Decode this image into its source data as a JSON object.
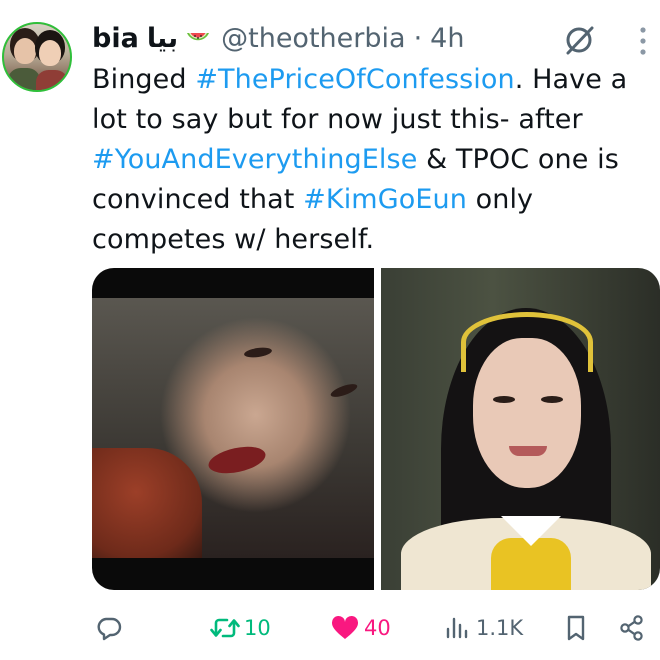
{
  "author": {
    "name": "bia",
    "name_arabic": "بيا",
    "emoji_icon": "watermelon-icon",
    "handle": "@theotherbia",
    "separator": "·",
    "time": "4h"
  },
  "tweet": {
    "lines": [
      [
        {
          "t": "Binged ",
          "tag": false
        },
        {
          "t": "#ThePriceOfConfession",
          "tag": true
        },
        {
          "t": ". Have a",
          "tag": false
        }
      ],
      [
        {
          "t": "lot to say but for now just this- after",
          "tag": false
        }
      ],
      [
        {
          "t": "#YouAndEverythingElse",
          "tag": true
        },
        {
          "t": " & TPOC one is",
          "tag": false
        }
      ],
      [
        {
          "t": "convinced that ",
          "tag": false
        },
        {
          "t": "#KimGoEun",
          "tag": true
        },
        {
          "t": " only",
          "tag": false
        }
      ],
      [
        {
          "t": "competes w/ herself.",
          "tag": false
        }
      ]
    ]
  },
  "media": {
    "images": [
      "photo-1",
      "photo-2"
    ]
  },
  "actions": {
    "reply_count": "",
    "retweet_count": "10",
    "like_count": "40",
    "views_count": "1.1K"
  },
  "colors": {
    "link": "#1d9bf0",
    "retweet_active": "#00ba7c",
    "like_active": "#f91880",
    "muted": "#536471"
  }
}
